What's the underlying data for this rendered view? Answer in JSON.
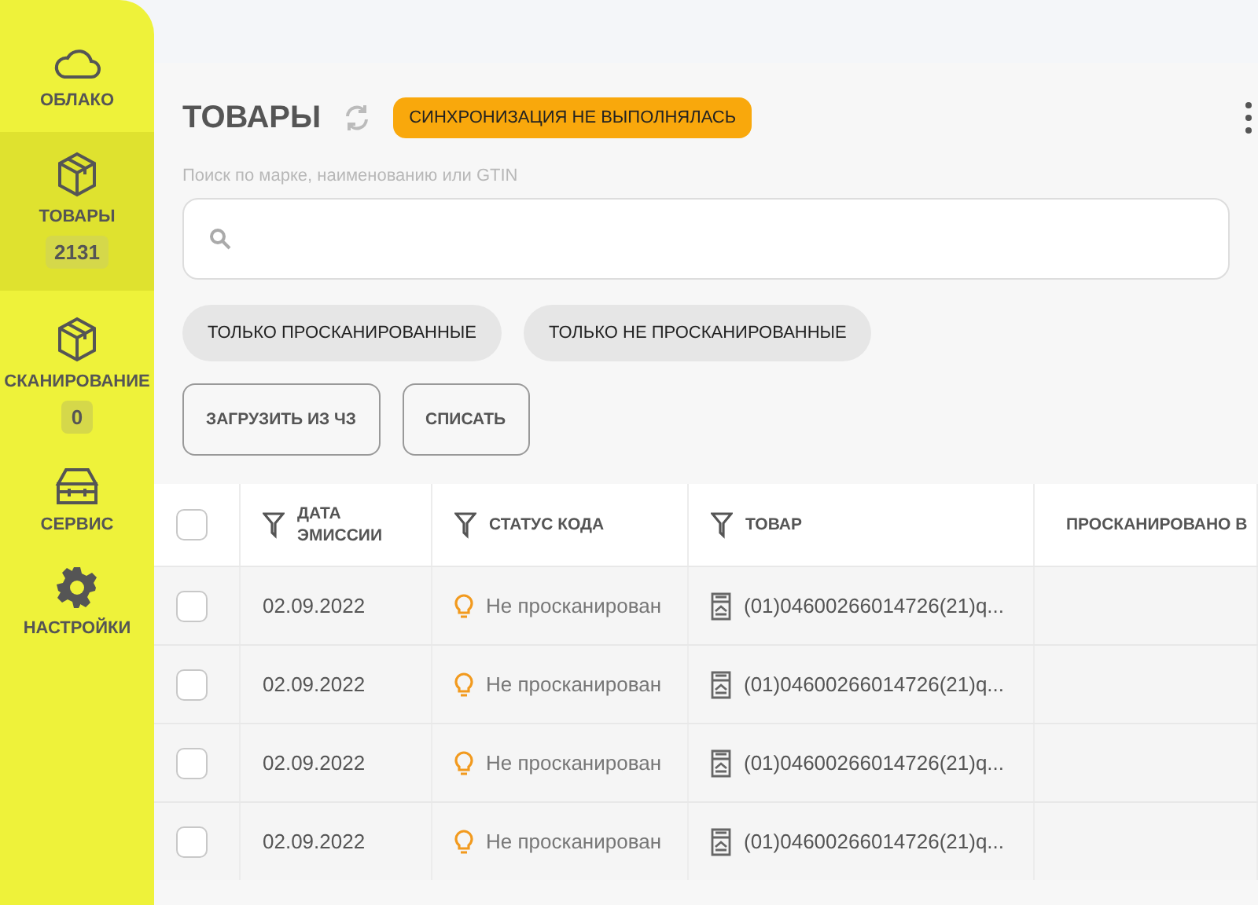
{
  "sidebar": {
    "items": [
      {
        "kind": "cloud",
        "label": "ОБЛАКО",
        "selected": false
      },
      {
        "kind": "box",
        "label": "ТОВАРЫ",
        "badge": "2131",
        "selected": true
      },
      {
        "kind": "box",
        "label": "СКАНИРОВАНИЕ",
        "badge": "0",
        "selected": false
      },
      {
        "kind": "toolbox",
        "label": "СЕРВИС",
        "selected": false
      },
      {
        "kind": "gear",
        "label": "НАСТРОЙКИ",
        "selected": false
      }
    ]
  },
  "header": {
    "title": "ТОВАРЫ",
    "sync_status": "СИНХРОНИЗАЦИЯ НЕ ВЫПОЛНЯЛАСЬ"
  },
  "search": {
    "label": "Поиск по марке, наименованию или GTIN"
  },
  "filters": [
    {
      "label": "ТОЛЬКО ПРОСКАНИРОВАННЫЕ",
      "selected": false
    },
    {
      "label": "ТОЛЬКО НЕ ПРОСКАНИРОВАННЫЕ",
      "selected": false
    }
  ],
  "actions": [
    "ЗАГРУЗИТЬ ИЗ ЧЗ",
    "СПИСАТЬ"
  ],
  "table": {
    "select_all_checked": false,
    "columns": [
      {
        "label": "ДАТА ЭМИССИИ",
        "filter": true
      },
      {
        "label": "СТАТУС КОДА",
        "filter": true
      },
      {
        "label": "ТОВАР",
        "filter": true
      },
      {
        "label": "ПРОСКАНИРОВАНО В",
        "filter": false
      }
    ],
    "rows": [
      {
        "checked": false,
        "date": "02.09.2022",
        "status": "Не просканирован",
        "product": "(01)04600266014726(21)q..."
      },
      {
        "checked": false,
        "date": "02.09.2022",
        "status": "Не просканирован",
        "product": "(01)04600266014726(21)q..."
      },
      {
        "checked": false,
        "date": "02.09.2022",
        "status": "Не просканирован",
        "product": "(01)04600266014726(21)q..."
      },
      {
        "checked": false,
        "date": "02.09.2022",
        "status": "Не просканирован",
        "product": "(01)04600266014726(21)q..."
      }
    ]
  }
}
